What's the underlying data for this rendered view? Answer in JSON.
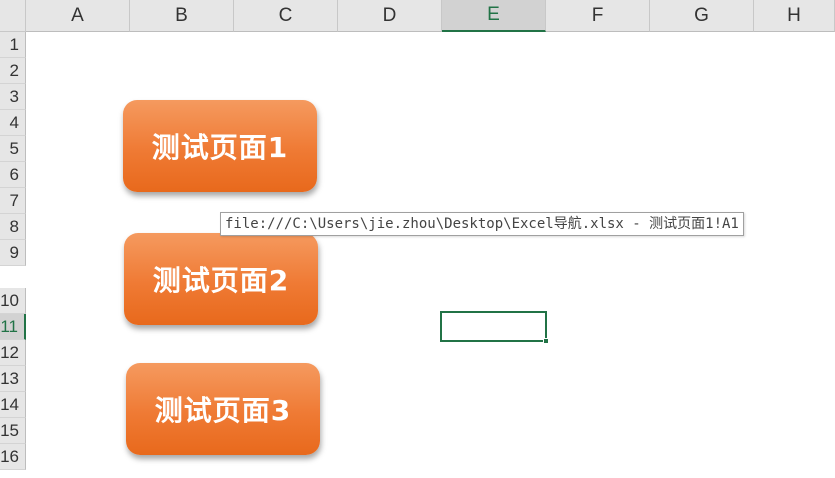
{
  "columns": [
    "A",
    "B",
    "C",
    "D",
    "E",
    "F",
    "G",
    "H"
  ],
  "selected_column": "E",
  "rows": [
    "1",
    "2",
    "3",
    "4",
    "5",
    "6",
    "7",
    "8",
    "9",
    "10",
    "11",
    "12",
    "13",
    "14",
    "15",
    "16"
  ],
  "selected_row": "11",
  "buttons": [
    {
      "label": "测试页面1"
    },
    {
      "label": "测试页面2"
    },
    {
      "label": "测试页面3"
    }
  ],
  "tooltip": {
    "text": "file:///C:\\Users\\jie.zhou\\Desktop\\Excel导航.xlsx - 测试页面1!A1"
  },
  "colors": {
    "button_top": "#f59a5f",
    "button_bottom": "#e8691c",
    "selection": "#217346",
    "header_bg": "#e6e6e6"
  }
}
